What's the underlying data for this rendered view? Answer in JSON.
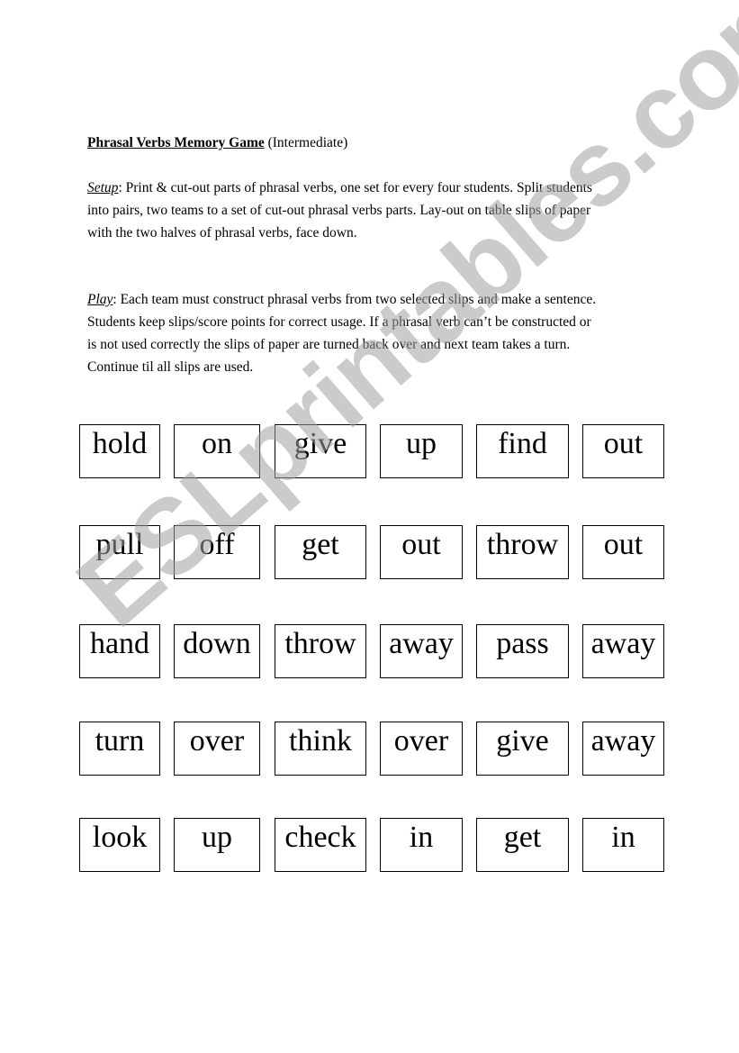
{
  "document": {
    "title": "Phrasal Verbs Memory Game",
    "level": "(Intermediate)",
    "setup": {
      "label": "Setup",
      "text": ": Print & cut-out parts of phrasal verbs, one set for every four students. Split students into pairs, two teams to a set of cut-out phrasal verbs parts.  Lay-out on table slips of paper with the two halves of phrasal verbs, face down."
    },
    "play": {
      "label": "Play",
      "text": ": Each team must construct phrasal verbs from two selected slips and make a sentence.  Students keep slips/score points for correct usage.  If a phrasal verb can’t be constructed or is not used correctly the slips of paper are turned back over and next team takes a turn.  Continue til all slips are used."
    }
  },
  "cards": [
    [
      "hold",
      "on",
      "give",
      "up",
      "find",
      "out"
    ],
    [
      "pull",
      "off",
      "get",
      "out",
      "throw",
      "out"
    ],
    [
      "hand",
      "down",
      "throw",
      "away",
      "pass",
      "away"
    ],
    [
      "turn",
      "over",
      "think",
      "over",
      "give",
      "away"
    ],
    [
      "look",
      "up",
      "check",
      "in",
      "get",
      "in"
    ]
  ],
  "watermark": "ESLprintables.com"
}
